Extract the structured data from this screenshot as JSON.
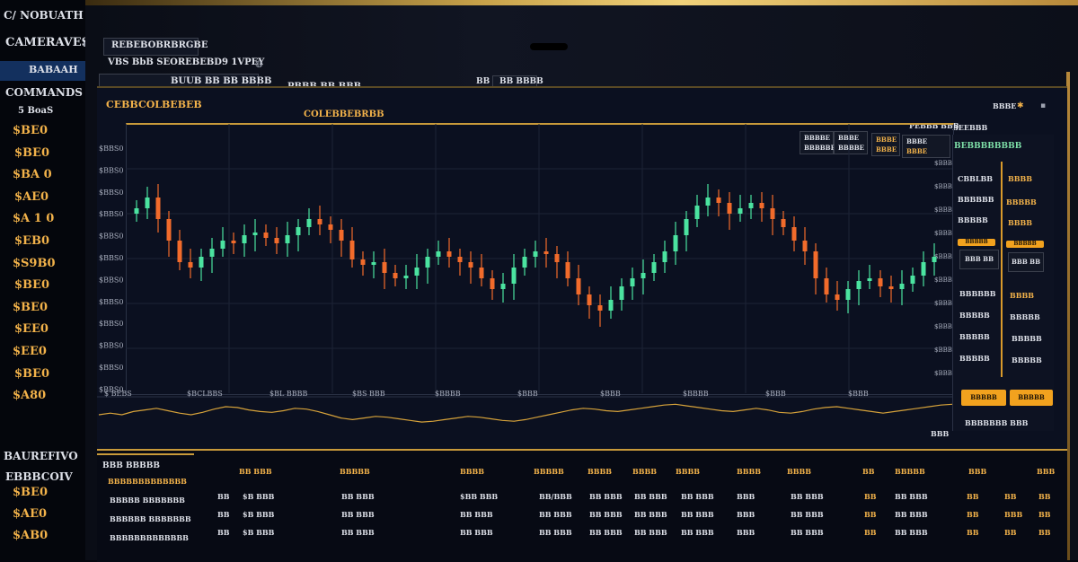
{
  "window_title": "C/ NOBUATH OT GES TEUBBO",
  "sidebar": {
    "title": "CAMERAVES",
    "active_item": "BABAAH",
    "section_label": "COMMANDS",
    "small_label": "5 BoaS",
    "values": [
      "$BE0",
      "$BE0",
      "$BA 0",
      "$AE0",
      "$A 1 0",
      "$EB0",
      "$S9B0",
      "$BE0",
      "$BE0",
      "$EE0",
      "$EE0",
      "$BE0",
      "$A80"
    ],
    "bottom_label": "BAUREFIVO",
    "bottom_section": "EBBBCOIV",
    "bottom_values": [
      "$BE0",
      "$AE0",
      "$AB0"
    ]
  },
  "toolbar": {
    "tab_label": "REBEBOBRBRGBE",
    "subtitle": "VBS BbB SEOREBEBD9 1VPEY",
    "search_icon": "search-icon",
    "field_1": "BUUB BB BB BBBB",
    "field_2": "PBBB BB BBB",
    "field_3": "BB",
    "field_4": "BB BBBB"
  },
  "chart_header": {
    "title": "CEBBCOLBEBEB",
    "center_title": "COLEBBEBRBB",
    "right_small": "BBBE",
    "right_label1": "PEBBB BBB",
    "right_label2": "BEEBBB",
    "buttons": [
      {
        "top": "BBBBE",
        "bottom": "BBBBBE"
      },
      {
        "top": "BBBE",
        "bottom": "BBBBE"
      },
      {
        "top": "BBBE",
        "bottom": "BBBE"
      },
      {
        "top": "BBBE",
        "bottom": "BBBE"
      }
    ]
  },
  "chart_data": {
    "type": "candlestick",
    "y_ticks": [
      "$BBS0",
      "$BBS0",
      "$BBS0",
      "$BBS0",
      "$BBS0",
      "$BBS0",
      "$BBS0",
      "$BBS0",
      "$BBS0",
      "$BBS0",
      "$BBS0",
      "$BBS0"
    ],
    "x_labels": [
      "$ BEBS",
      "$BCLBBS",
      "$BL BBBB",
      "$BS BBB",
      "$BBBB",
      "$BBB",
      "$BBB",
      "$BBBB",
      "$BBB",
      "$BBB"
    ],
    "right_axis": [
      "$BBB",
      "$BBB",
      "$BBB",
      "$BBB",
      "$BBB",
      "$BBB",
      "$BBB",
      "$BBB",
      "$BBB",
      "$BBB"
    ],
    "bull_color": "#4be3a0",
    "bear_color": "#f26b2b",
    "close_series": [
      62,
      66,
      58,
      50,
      42,
      40,
      44,
      47,
      50,
      49,
      52,
      53,
      51,
      49,
      52,
      55,
      58,
      56,
      54,
      50,
      43,
      41,
      42,
      38,
      36,
      37,
      40,
      44,
      46,
      44,
      42,
      40,
      36,
      32,
      34,
      40,
      44,
      46,
      45,
      42,
      36,
      30,
      26,
      24,
      28,
      33,
      36,
      38,
      42,
      46,
      52,
      58,
      63,
      66,
      64,
      60,
      62,
      64,
      62,
      58,
      55,
      50,
      46,
      36,
      30,
      28,
      32,
      35,
      36,
      33,
      32,
      34,
      37,
      42,
      44
    ],
    "indicator_series": [
      40,
      42,
      40,
      44,
      46,
      48,
      45,
      42,
      40,
      43,
      47,
      50,
      49,
      46,
      44,
      43,
      45,
      48,
      47,
      44,
      40,
      36,
      34,
      36,
      38,
      37,
      35,
      33,
      31,
      32,
      34,
      36,
      38,
      37,
      35,
      33,
      32,
      34,
      37,
      40,
      43,
      46,
      48,
      47,
      45,
      44,
      46,
      48,
      50,
      52,
      53,
      51,
      49,
      47,
      45,
      44,
      46,
      48,
      46,
      43,
      42,
      44,
      47,
      49,
      50,
      48,
      46,
      44,
      42,
      44,
      46,
      48,
      50,
      52,
      53
    ]
  },
  "right_panel": {
    "header": "BEBBBBBBBB",
    "rows": [
      {
        "left": "CBBLBB",
        "right": "BBBB"
      },
      {
        "left": "BBBBBB",
        "right": "BBBBB"
      },
      {
        "left": "BBBBB",
        "right": "BBBB"
      }
    ],
    "orange_1": "BBBBB",
    "orange_2": "BBBBB",
    "box_1": "BBB BB",
    "box_2": "BBB BB",
    "rows2": [
      {
        "left": "BBBBBB",
        "right": "BBBB"
      },
      {
        "left": "BBBBB",
        "right": "BBBBB"
      },
      {
        "left": "BBBBB",
        "right": "BBBBB"
      },
      {
        "left": "BBBBB",
        "right": "BBBBB"
      }
    ],
    "btn_a": "BBBBB",
    "btn_b": "BBBBB",
    "footer": "BBBBBBB BBB",
    "footer_val": "BBB"
  },
  "orders": {
    "tab": "BBB BBBBB",
    "headers": [
      "BBBBBBBBBBBBB",
      "BB BBB",
      "BBBBB",
      "BBBB",
      "BBBBB",
      "BBBB",
      "BBBB",
      "BBBB",
      "BBBB",
      "BBBB",
      "BB",
      "BBBBB",
      "BBB",
      "BBB"
    ],
    "rows": [
      {
        "name": "BBBBB BBBBBBB",
        "a": "BB",
        "b": "$B BBB",
        "c": "BB BBB",
        "d": "$BB BBB",
        "e": "BB/BBB",
        "f": "BB BBB",
        "g": "BB BBB",
        "h": "BB BBB",
        "i": "BBB",
        "j": "BB BBB",
        "k": "BB",
        "l": "BB BBB",
        "m": "BB",
        "n": "BB",
        "o": "BB"
      },
      {
        "name": "BBBBBB BBBBBBB",
        "a": "BB",
        "b": "$B BBB",
        "c": "BB BBB",
        "d": "BB BBB",
        "e": "BB BBB",
        "f": "BB BBB",
        "g": "BB BBB",
        "h": "BB BBB",
        "i": "BBB",
        "j": "BB BBB",
        "k": "BB",
        "l": "BB BBB",
        "m": "BB",
        "n": "BBB",
        "o": "BB"
      },
      {
        "name": "BBBBBBBBBBBBB",
        "a": "BB",
        "b": "$B BBB",
        "c": "BB BBB",
        "d": "BB BBB",
        "e": "BB BBB",
        "f": "BB BBB",
        "g": "BB BBB",
        "h": "BB BBB",
        "i": "BBB",
        "j": "BB BBB",
        "k": "BB",
        "l": "BB BBB",
        "m": "BB",
        "n": "BB",
        "o": "BB"
      }
    ]
  },
  "accent_gold": "#f2b24a",
  "panel_bg": "#0b1020"
}
